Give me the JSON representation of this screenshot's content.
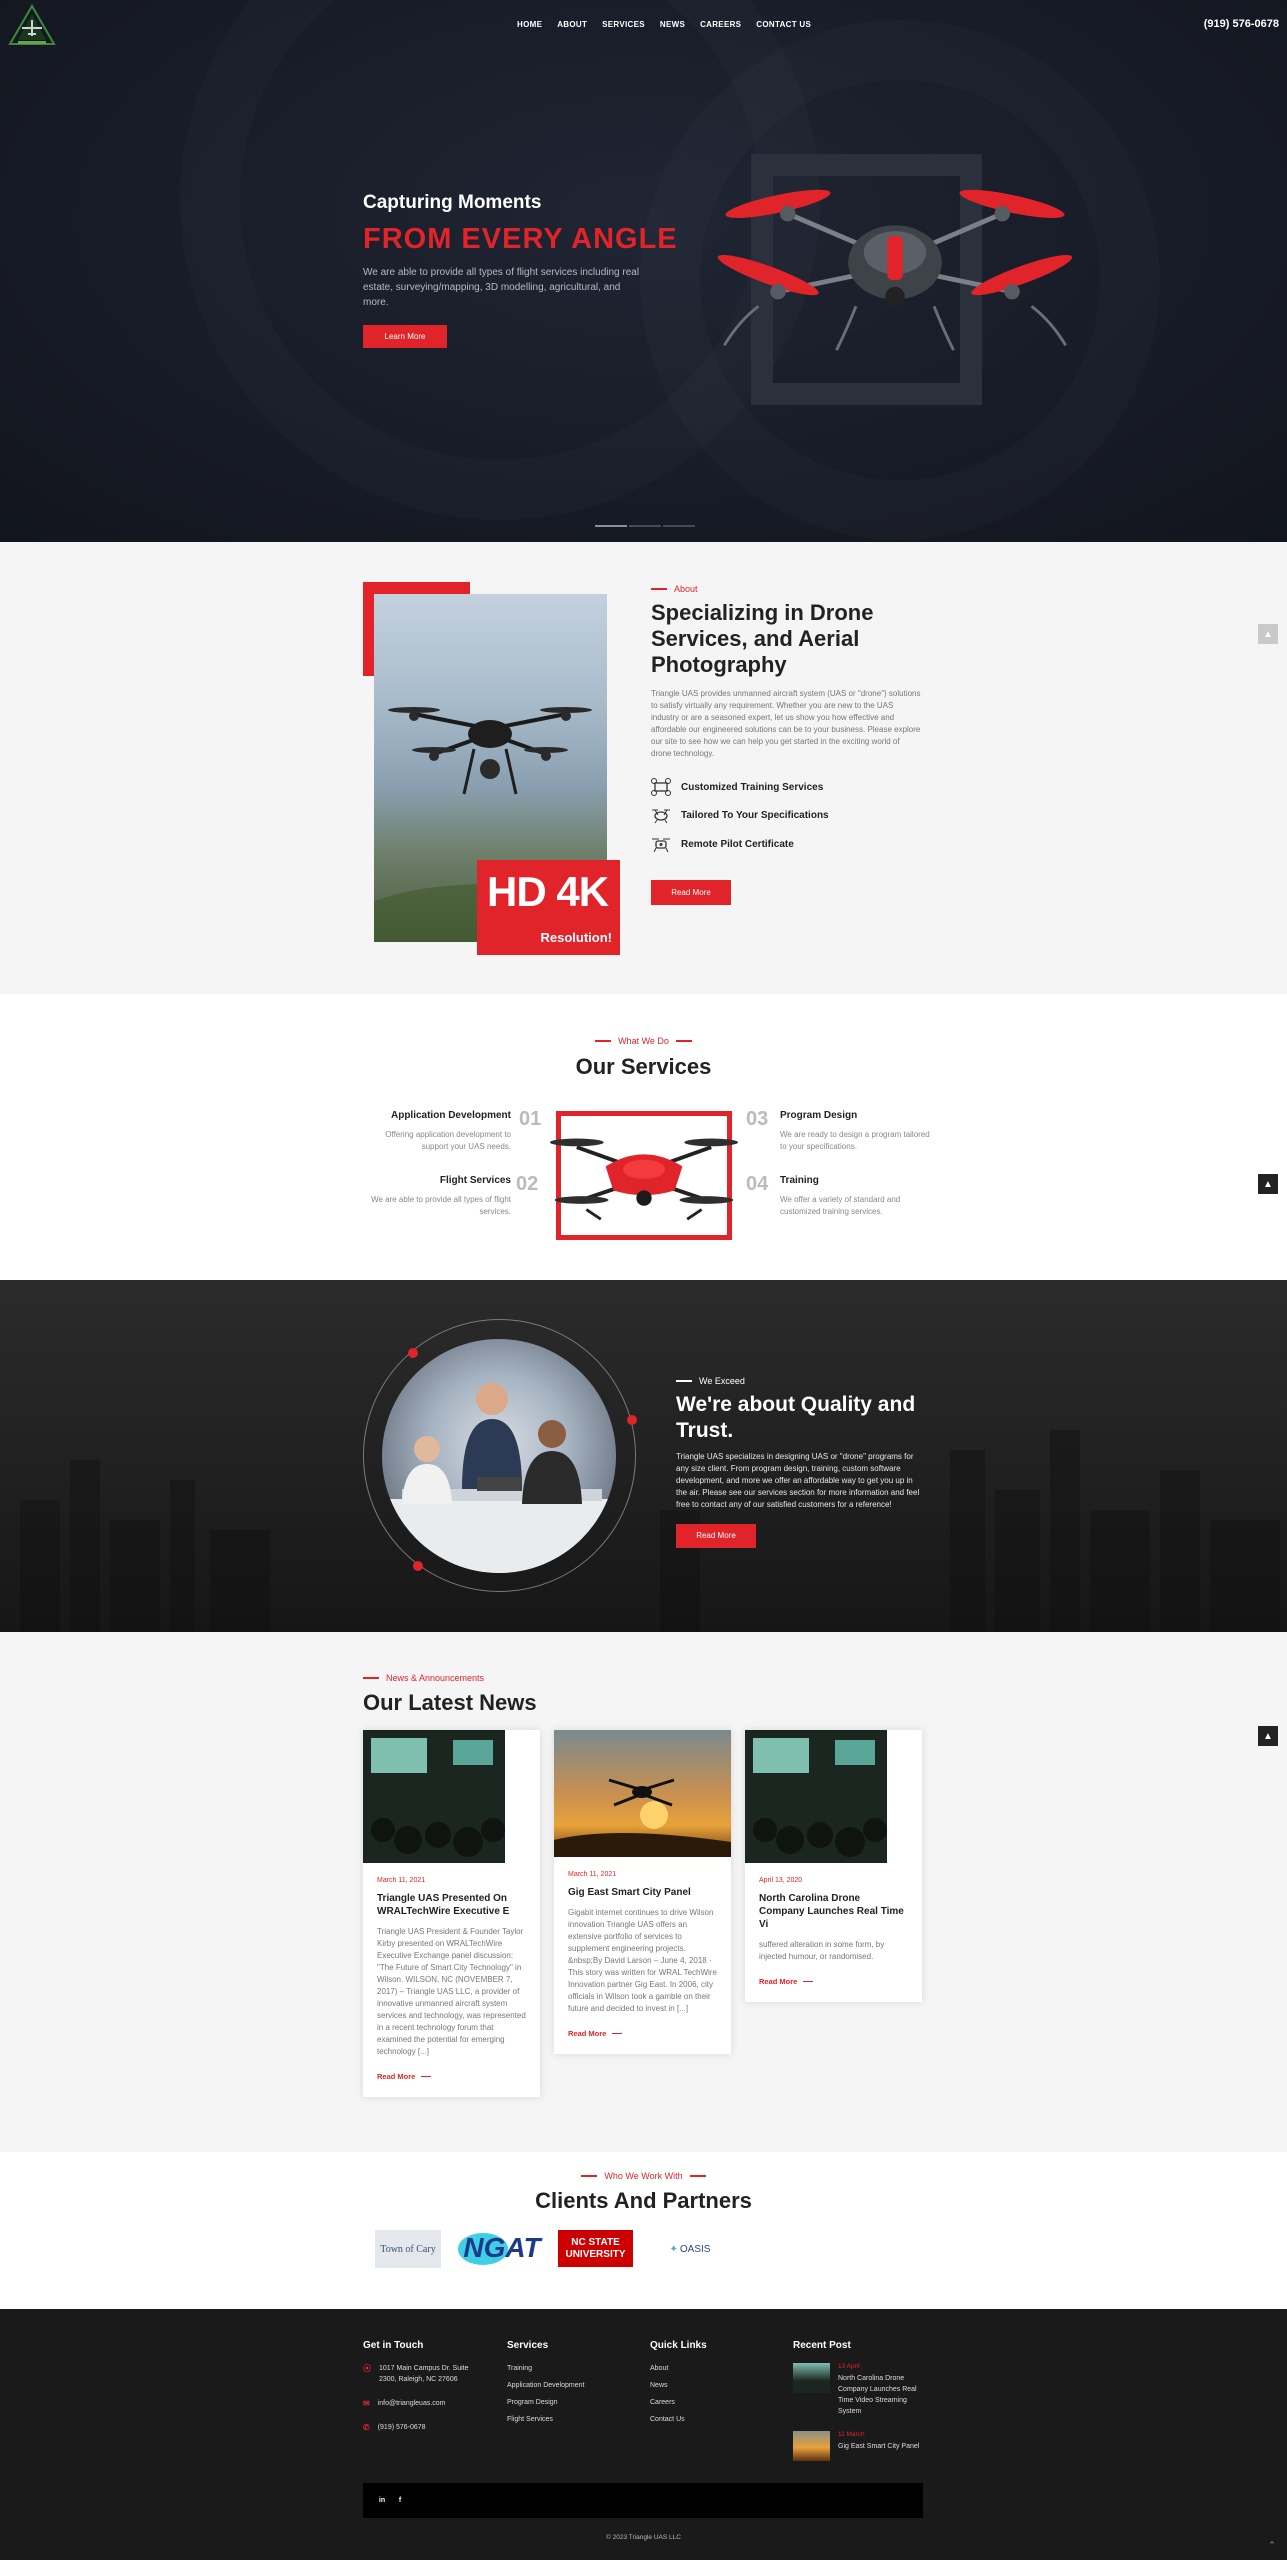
{
  "header": {
    "nav": [
      "HOME",
      "ABOUT",
      "SERVICES",
      "NEWS",
      "CAREERS",
      "CONTACT US"
    ],
    "phone": "(919) 576-0678"
  },
  "hero": {
    "subtitle": "Capturing Moments",
    "title": "FROM EVERY ANGLE",
    "text": "We are able to provide all types of flight services including real estate, surveying/mapping, 3D modelling, agricultural, and more.",
    "button": "Learn More",
    "slides": 3,
    "active_slide": 1
  },
  "about": {
    "eyebrow": "About",
    "title": "Specializing in Drone Services, and Aerial Photography",
    "text": "Triangle UAS provides unmanned aircraft system (UAS or \"drone\") solutions to satisfy virtually any requirement. Whether you are new to the UAS industry or are a seasoned expert, let us show you how effective and affordable our engineered solutions can be to your business. Please explore our site to see how we can help you get started in the exciting world of drone technology.",
    "features": [
      "Customized Training Services",
      "Tailored To Your Specifications",
      "Remote Pilot Certificate"
    ],
    "button": "Read More",
    "badge_big": "HD 4K",
    "badge_small": "Resolution!"
  },
  "services": {
    "eyebrow": "What We Do",
    "title": "Our Services",
    "items": [
      {
        "num": "01",
        "title": "Application Development",
        "desc": "Offering application development to support your UAS needs."
      },
      {
        "num": "02",
        "title": "Flight Services",
        "desc": "We are able to provide all types of flight services."
      },
      {
        "num": "03",
        "title": "Program Design",
        "desc": "We are ready to design a program tailored to your specifications."
      },
      {
        "num": "04",
        "title": "Training",
        "desc": "We offer a variety of standard and customized training services."
      }
    ]
  },
  "quality": {
    "eyebrow": "We Exceed",
    "title": "We're about Quality and Trust.",
    "text": "Triangle UAS specializes in designing UAS or \"drone\" programs for any size client. From program design, training, custom software development, and more we offer an affordable way to get you up in the air. Please see our services section for more information and feel free to contact any of our satisfied customers for a reference!",
    "button": "Read More"
  },
  "news": {
    "eyebrow": "News & Announcements",
    "title": "Our Latest News",
    "read_more": "Read More",
    "posts": [
      {
        "date": "March 11, 2021",
        "title": "Triangle UAS Presented On WRALTechWire Executive E",
        "text": "Triangle UAS President & Founder Taylor Kirby presented on WRALTechWire Executive Exchange panel discussion: \"The Future of Smart City Technology\" in Wilson. WILSON, NC (NOVEMBER 7, 2017) – Triangle UAS LLC, a provider of innovative unmanned aircraft system services and technology, was represented in a recent technology forum that examined the potential for emerging technology [...]"
      },
      {
        "date": "March 11, 2021",
        "title": "Gig East Smart City Panel",
        "text": "Gigabit internet continues to drive Wilson innovation Triangle UAS offers an extensive portfolio of services to supplement engineering projects. &nbsp;By David Larson – June 4, 2018 · This story was written for WRAL TechWire Innovation partner Gig East. In 2006, city officials in Wilson took a gamble on their future and decided to invest in [...]"
      },
      {
        "date": "April 13, 2020",
        "title": "North Carolina Drone Company Launches Real Time Vi",
        "text": "suffered alteration in some form, by injected humour, or randomised."
      }
    ]
  },
  "clients": {
    "eyebrow": "Who We Work With",
    "title": "Clients And Partners",
    "logos": [
      "Town of Cary",
      "NGAT",
      "NC STATE UNIVERSITY",
      "OASIS"
    ]
  },
  "footer": {
    "contact": {
      "title": "Get in Touch",
      "address": "1017 Main Campus Dr. Suite 2300, Raleigh, NC 27606",
      "email": "info@triangleuas.com",
      "phone": "(919) 576-0678"
    },
    "services": {
      "title": "Services",
      "items": [
        "Training",
        "Application Development",
        "Program Design",
        "Flight Services"
      ]
    },
    "links": {
      "title": "Quick Links",
      "items": [
        "About",
        "News",
        "Careers",
        "Contact Us"
      ]
    },
    "recent": {
      "title": "Recent Post",
      "posts": [
        {
          "date": "13 April",
          "title": "North Carolina Drone Company Launches Real Time Video Streaming System"
        },
        {
          "date": "11 March",
          "title": "Gig East Smart City Panel"
        }
      ]
    },
    "social": [
      "in",
      "f"
    ],
    "copyright": "© 2023 Triangle UAS LLC"
  },
  "colors": {
    "accent": "#e0242a",
    "dark": "#171b26",
    "footer": "#1a1a1a"
  }
}
